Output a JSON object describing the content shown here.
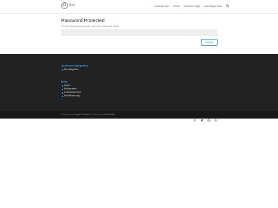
{
  "header": {
    "logo_text": "divi",
    "logo_mark": "D",
    "nav": [
      "Contact Info",
      "Home",
      "Sample Page",
      "Uncategorized"
    ]
  },
  "main": {
    "title": "Password Protected",
    "description": "To view this protected post, enter the password below:",
    "password_value": "",
    "submit_label": "Submit"
  },
  "footer": {
    "archives": {
      "title": "Archives/Categories",
      "items": [
        "No categories"
      ]
    },
    "meta": {
      "title": "Meta",
      "items": [
        "Log in",
        "Entries feed",
        "Comments feed",
        "WordPress.org"
      ]
    }
  },
  "bottom": {
    "credits_prefix": "Designed by",
    "theme_link": "Elegant Themes",
    "separator": " | Powered by ",
    "wp_link": "WordPress",
    "social_icons": [
      "facebook-icon",
      "twitter-icon",
      "instagram-icon",
      "rss-icon"
    ]
  },
  "colors": {
    "accent": "#2ea3f2",
    "footer_bg": "#222222",
    "bottom_bg": "#171717"
  }
}
